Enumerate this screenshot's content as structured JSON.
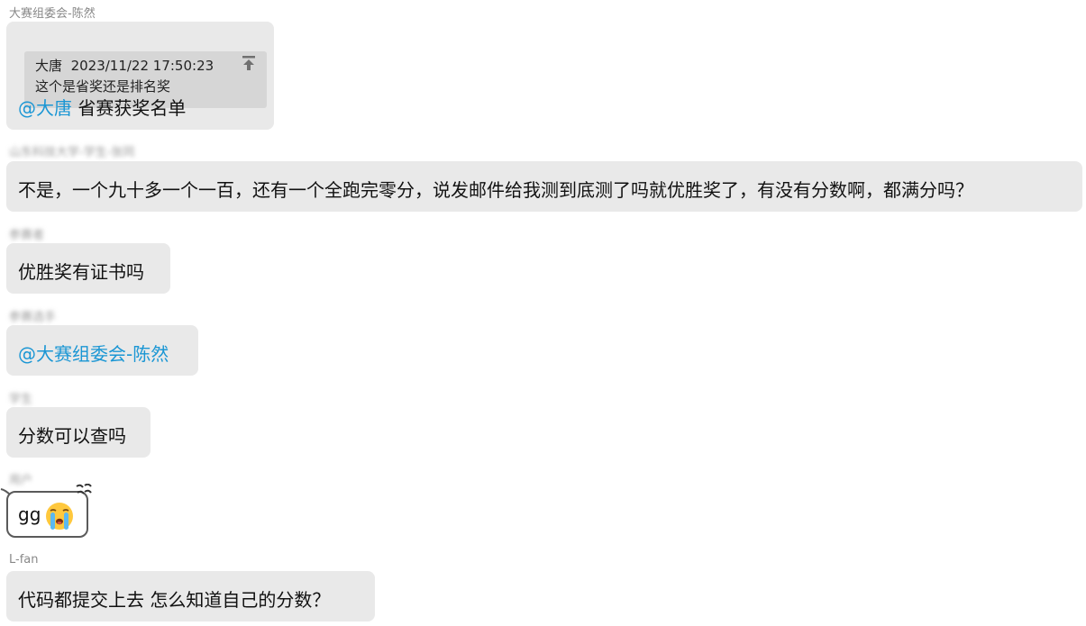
{
  "messages": [
    {
      "sender": "大赛组委会-陈然",
      "quote": {
        "author": "大唐",
        "time": "2023/11/22 17:50:23",
        "text": "这个是省奖还是排名奖"
      },
      "mention": "@大唐",
      "text": "省赛获奖名单"
    },
    {
      "sender": "山东科技大学-学生-张同",
      "text": "不是，一个九十多一个一百，还有一个全跑完零分，说发邮件给我测到底测了吗就优胜奖了，有没有分数啊，都满分吗？"
    },
    {
      "sender": "参赛者",
      "text": "优胜奖有证书吗"
    },
    {
      "sender": "参赛选手",
      "mention": "@大赛组委会-陈然"
    },
    {
      "sender": "学生",
      "text": "分数可以查吗"
    },
    {
      "sender": "用户",
      "text": "gg",
      "emoji": "crying-face-emoji"
    },
    {
      "sender": "L-fan",
      "text": "代码都提交上去 怎么知道自己的分数？"
    }
  ],
  "colors": {
    "bubble": "#e9e9e9",
    "quote_bg": "#d6d6d6",
    "mention": "#1a96d4",
    "sender": "#888888"
  }
}
